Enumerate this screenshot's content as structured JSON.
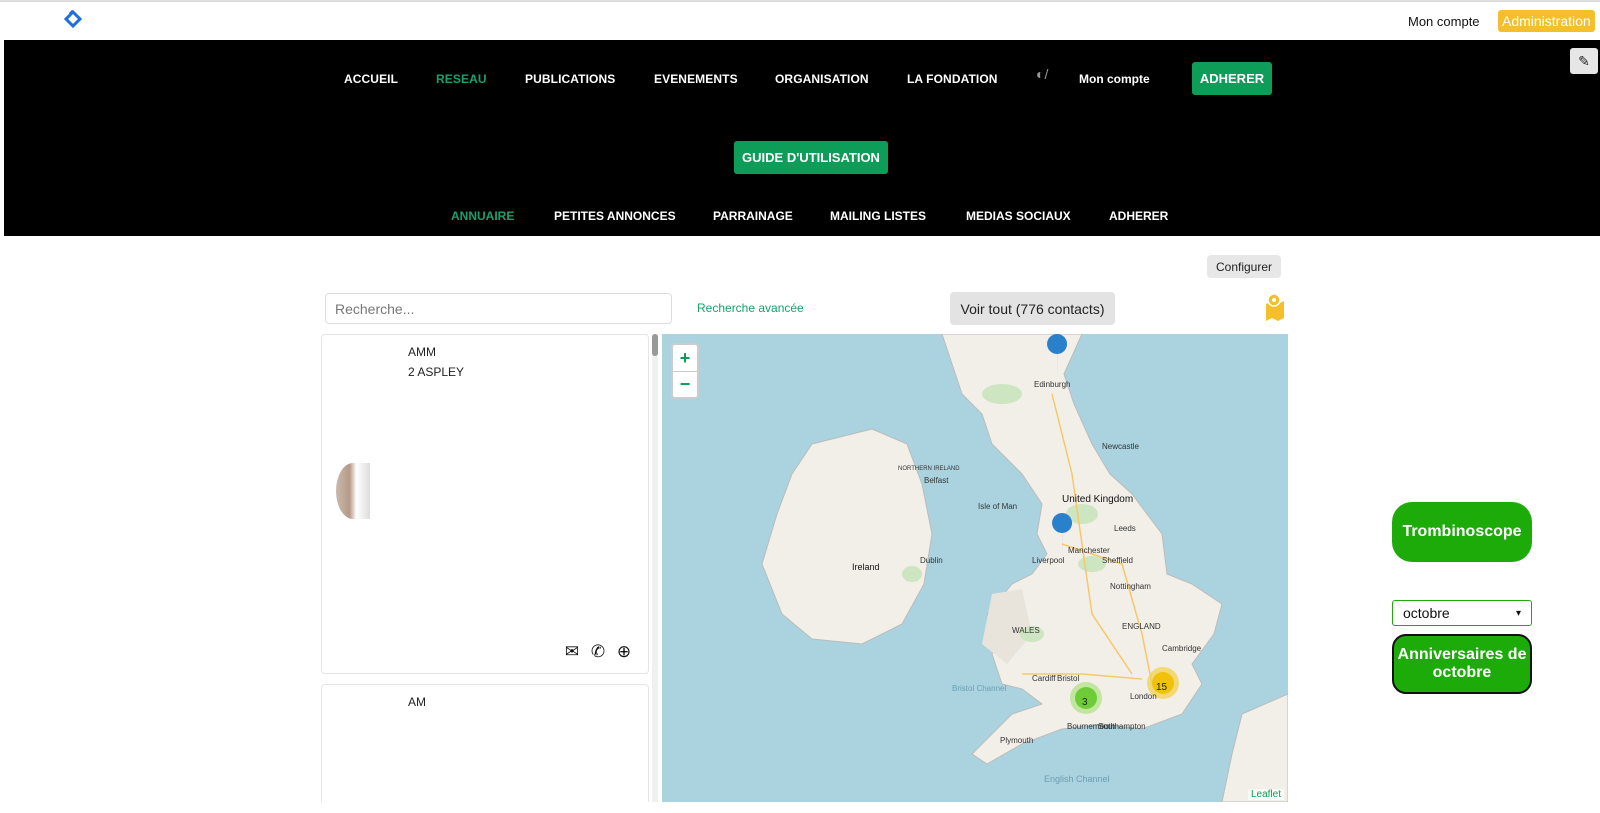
{
  "topbar": {
    "account": "Mon compte",
    "admin": "Administration"
  },
  "nav": {
    "items": [
      "ACCUEIL",
      "RESEAU",
      "PUBLICATIONS",
      "EVENEMENTS",
      "ORGANISATION",
      "LA FONDATION"
    ],
    "account": "Mon compte",
    "adherer": "ADHERER",
    "guide": "GUIDE D'UTILISATION"
  },
  "subnav": {
    "items": [
      "ANNUAIRE",
      "PETITES ANNONCES",
      "PARRAINAGE",
      "MAILING LISTES",
      "MEDIAS SOCIAUX",
      "ADHERER"
    ]
  },
  "toolbar": {
    "configure": "Configurer",
    "search_placeholder": "Recherche...",
    "advanced": "Recherche avancée",
    "voir_tout": "Voir tout (776 contacts)"
  },
  "cards": [
    {
      "line1": "AMM",
      "line2": "2 ASPLEY"
    },
    {
      "line1": "AM"
    }
  ],
  "map": {
    "zoom_in": "+",
    "zoom_out": "−",
    "attribution": "Leaflet",
    "labels": [
      "Edinburgh",
      "Newcastle",
      "United Kingdom",
      "NORTHERN IRELAND",
      "Belfast",
      "Isle of Man",
      "Ireland",
      "Dublin",
      "Leeds",
      "Manchester",
      "Liverpool",
      "Sheffield",
      "Nottingham",
      "WALES",
      "ENGLAND",
      "Cardiff",
      "Bristol",
      "London",
      "Southampton",
      "Bournemouth",
      "Plymouth",
      "English Channel",
      "Bristol Channel",
      "Cambridge"
    ],
    "clusters": [
      {
        "count": "3"
      },
      {
        "count": "15"
      }
    ]
  },
  "right": {
    "trombi": "Trombinoscope",
    "month": "octobre",
    "anniv": "Anniversaires de octobre"
  }
}
